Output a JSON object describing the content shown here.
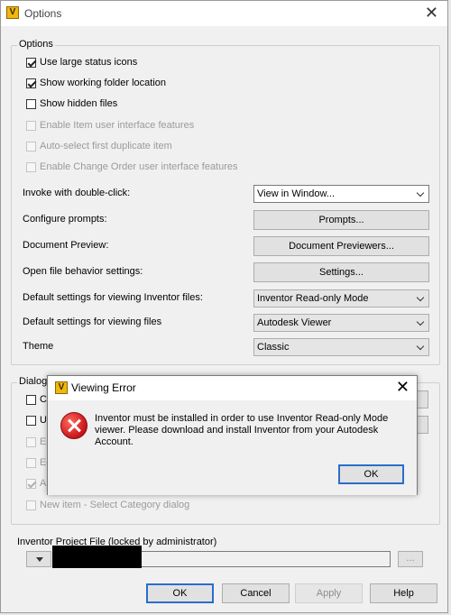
{
  "window": {
    "title": "Options",
    "icon": "autodesk-vault-icon",
    "close_glyph": "✕"
  },
  "options_group": {
    "legend": "Options",
    "checkboxes": [
      {
        "label": "Use large status icons",
        "checked": true,
        "enabled": true
      },
      {
        "label": "Show working folder location",
        "checked": true,
        "enabled": true
      },
      {
        "label": "Show hidden files",
        "checked": false,
        "enabled": true
      },
      {
        "label": "Enable Item user interface features",
        "checked": false,
        "enabled": false
      },
      {
        "label": "Auto-select first duplicate item",
        "checked": false,
        "enabled": false
      },
      {
        "label": "Enable Change Order user interface features",
        "checked": false,
        "enabled": false
      }
    ],
    "settings": {
      "invoke_label": "Invoke with double-click:",
      "invoke_value": "View in Window...",
      "prompts_label": "Configure prompts:",
      "prompts_button": "Prompts...",
      "preview_label": "Document Preview:",
      "preview_button": "Document Previewers...",
      "open_file_label": "Open file behavior settings:",
      "open_file_button": "Settings...",
      "inventor_label": "Default settings for viewing Inventor files:",
      "inventor_value": "Inventor Read-only Mode",
      "viewing_label": "Default settings for viewing files",
      "viewing_value": "Autodesk Viewer",
      "theme_label": "Theme",
      "theme_value": "Classic"
    }
  },
  "dialog_group": {
    "legend_fragment": "Dialog S",
    "checkbox_fragments": [
      {
        "label": "Ch",
        "checked": false,
        "enabled": true
      },
      {
        "label": "Ur",
        "checked": false,
        "enabled": true
      },
      {
        "label": "Ed",
        "checked": false,
        "enabled": false
      },
      {
        "label": "Ed",
        "checked": false,
        "enabled": false
      },
      {
        "label": "As",
        "checked": true,
        "enabled": false
      }
    ],
    "new_item": {
      "label": "New item - Select Category dialog",
      "checked": false,
      "enabled": false
    }
  },
  "project_file": {
    "label": "Inventor Project File (locked by administrator)",
    "browse_label": "..."
  },
  "footer": {
    "ok": "OK",
    "cancel": "Cancel",
    "apply": "Apply",
    "help": "Help"
  },
  "error_dialog": {
    "title": "Viewing Error",
    "close_glyph": "✕",
    "message": "Inventor must be installed in order to use Inventor Read-only Mode viewer. Please download and install Inventor from your Autodesk Account.",
    "ok": "OK"
  }
}
